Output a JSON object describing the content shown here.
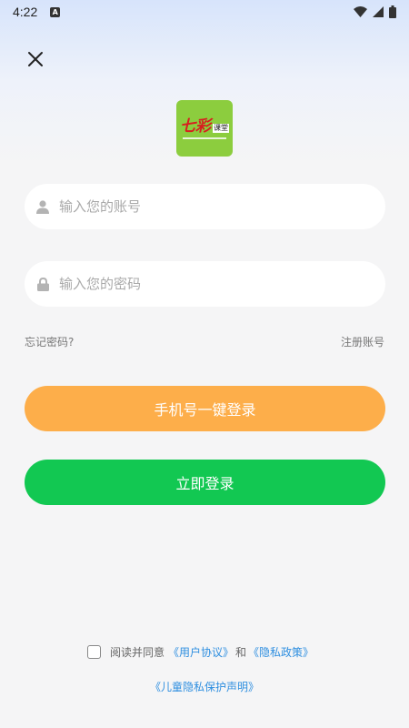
{
  "status_bar": {
    "time": "4:22",
    "notification_icon": "app-notification-icon",
    "icons": [
      "wifi-icon",
      "signal-icon",
      "battery-icon"
    ]
  },
  "header": {
    "close_icon": "close-icon"
  },
  "logo": {
    "main_text": "七彩",
    "sub_text": "课堂"
  },
  "login_form": {
    "account_placeholder": "输入您的账号",
    "password_placeholder": "输入您的密码",
    "account_value": "",
    "password_value": "",
    "forgot_password": "忘记密码?",
    "register": "注册账号"
  },
  "buttons": {
    "phone_login": "手机号一键登录",
    "login_now": "立即登录"
  },
  "agreement": {
    "prefix": "阅读并同意",
    "user_agreement": "《用户协议》",
    "and": "和",
    "privacy_policy": "《隐私政策》",
    "child_privacy": "《儿童隐私保护声明》",
    "checked": false
  },
  "colors": {
    "orange_button": "#fdae4a",
    "green_button": "#12c852",
    "link_blue": "#2f8fe0",
    "logo_bg": "#8ccd3e"
  }
}
